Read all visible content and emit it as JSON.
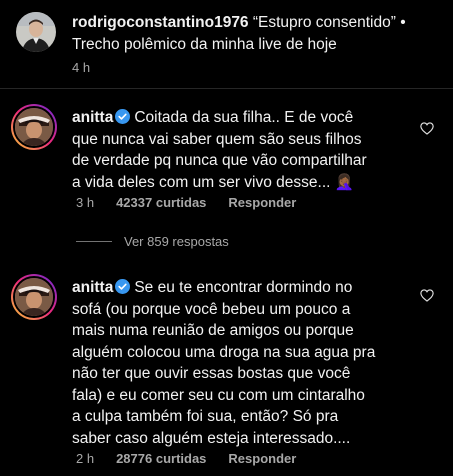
{
  "caption": {
    "username": "rodrigoconstantino1976",
    "text_part1": " “Estupro consentido” •",
    "text_part2": "Trecho polêmico da minha live de hoje",
    "time": "4 h"
  },
  "comments": [
    {
      "username": "anitta",
      "lines": [
        "Coitada da sua filha.. E de você",
        "que nunca vai saber quem são seus filhos",
        "de verdade pq nunca que vão compartilhar",
        "a vida deles com um ser vivo desse... 🤦🏾‍♀️"
      ],
      "time": "3 h",
      "likes": "42337 curtidas",
      "reply_label": "Responder"
    },
    {
      "username": "anitta",
      "lines": [
        "Se eu te encontrar dormindo no",
        "sofá (ou porque você bebeu um pouco a",
        "mais numa reunião de amigos ou porque",
        "alguém colocou uma droga na sua agua pra",
        "não ter que ouvir essas bostas que você",
        "fala) e eu comer seu cu com um cintaralho",
        "a culpa também foi sua, então? Só pra",
        "saber caso alguém esteja interessado...."
      ],
      "time": "2 h",
      "likes": "28776 curtidas",
      "reply_label": "Responder"
    }
  ],
  "view_replies": "Ver 859 respostas",
  "icons": {
    "heart": "heart-outline-icon",
    "verified": "verified-badge-icon"
  },
  "colors": {
    "verified": "#3897f0",
    "muted": "#a8a8a8"
  }
}
